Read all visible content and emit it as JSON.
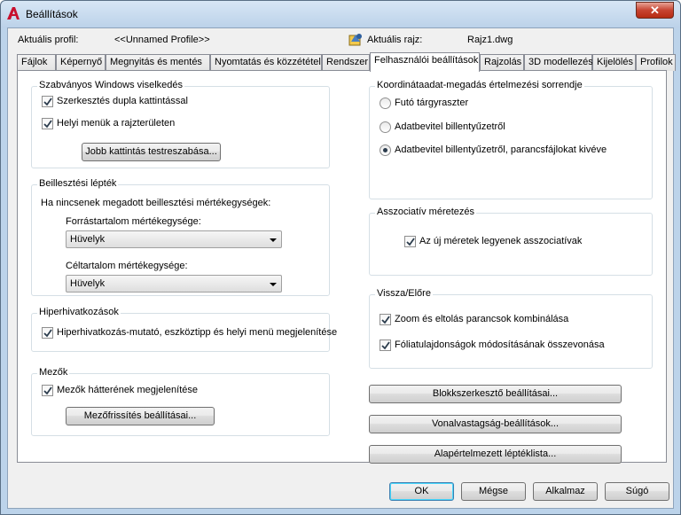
{
  "window": {
    "title": "Beállítások",
    "close_label": "✕"
  },
  "profile": {
    "current_profile_label": "Aktuális profil:",
    "current_profile_value": "<<Unnamed Profile>>",
    "current_drawing_label": "Aktuális rajz:",
    "current_drawing_value": "Rajz1.dwg"
  },
  "tabs": [
    {
      "label": "Fájlok"
    },
    {
      "label": "Képernyő"
    },
    {
      "label": "Megnyitás és mentés"
    },
    {
      "label": "Nyomtatás és közzététel"
    },
    {
      "label": "Rendszer"
    },
    {
      "label": "Felhasználói beállítások"
    },
    {
      "label": "Rajzolás"
    },
    {
      "label": "3D modellezés"
    },
    {
      "label": "Kijelölés"
    },
    {
      "label": "Profilok"
    }
  ],
  "active_tab": "Felhasználói beállítások",
  "windows_behavior": {
    "title": "Szabványos Windows viselkedés",
    "double_click_label": "Szerkesztés dupla kattintással",
    "double_click_checked": true,
    "shortcut_menus_label": "Helyi menük a rajzterületen",
    "shortcut_menus_checked": true,
    "right_click_button": "Jobb kattintás testreszabása..."
  },
  "insertion_scale": {
    "title": "Beillesztési lépték",
    "note": "Ha nincsenek megadott beillesztési mértékegységek:",
    "source_label": "Forrástartalom mértékegysége:",
    "source_value": "Hüvelyk",
    "target_label": "Céltartalom mértékegysége:",
    "target_value": "Hüvelyk"
  },
  "hyperlink": {
    "title": "Hiperhivatkozások",
    "cursor_label": "Hiperhivatkozás-mutató, eszköztipp és helyi menü megjelenítése",
    "cursor_checked": true
  },
  "fields": {
    "title": "Mezők",
    "background_label": "Mezők hátterének megjelenítése",
    "background_checked": true,
    "update_button": "Mezőfrissítés beállításai..."
  },
  "coordinate_priority": {
    "title": "Koordinátaadat-megadás értelmezési sorrendje",
    "options": [
      {
        "label": "Futó tárgyraszter",
        "selected": false
      },
      {
        "label": "Adatbevitel billentyűzetről",
        "selected": false
      },
      {
        "label": "Adatbevitel billentyűzetről, parancsfájlokat kivéve",
        "selected": true
      }
    ]
  },
  "associative": {
    "title": "Asszociatív méretezés",
    "new_dims_label": "Az új méretek legyenek asszociatívak",
    "new_dims_checked": true
  },
  "undo_redo": {
    "title": "Vissza/Előre",
    "zoom_pan_label": "Zoom és eltolás parancsok kombinálása",
    "zoom_pan_checked": true,
    "layer_props_label": "Fóliatulajdonságok módosításának összevonása",
    "layer_props_checked": true
  },
  "side_buttons": {
    "block_editor": "Blokkszerkesztő beállításai...",
    "lineweight": "Vonalvastagság-beállítások...",
    "scale_list": "Alapértelmezett léptéklista..."
  },
  "footer": {
    "ok": "OK",
    "cancel": "Mégse",
    "apply": "Alkalmaz",
    "help": "Súgó"
  }
}
